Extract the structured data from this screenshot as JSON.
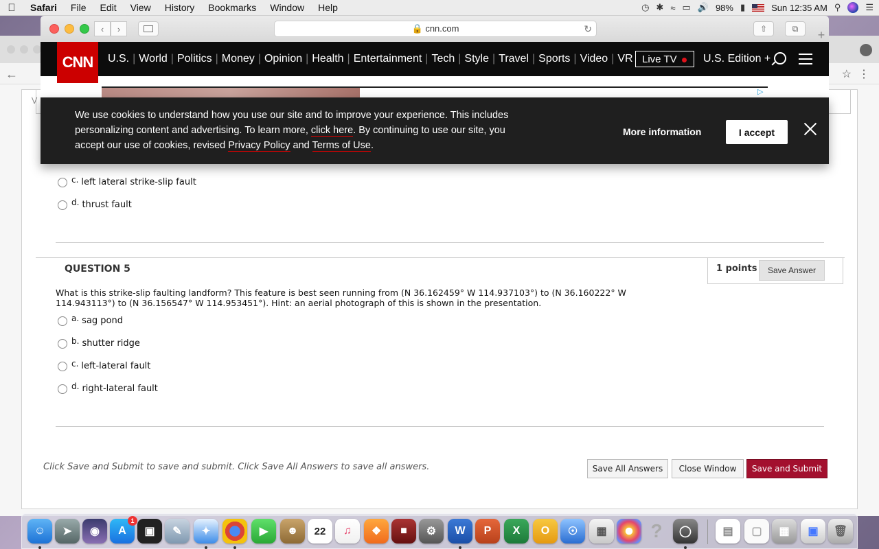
{
  "menubar": {
    "app": "Safari",
    "items": [
      "File",
      "Edit",
      "View",
      "History",
      "Bookmarks",
      "Window",
      "Help"
    ],
    "battery": "98%",
    "clock": "Sun 12:35 AM"
  },
  "safari": {
    "url": "cnn.com"
  },
  "cnn": {
    "logo": "CNN",
    "links": [
      "U.S.",
      "World",
      "Politics",
      "Money",
      "Opinion",
      "Health",
      "Entertainment",
      "Tech",
      "Style",
      "Travel",
      "Sports",
      "Video",
      "VR"
    ],
    "live_tv": "Live TV",
    "edition": "U.S. Edition +"
  },
  "cookie": {
    "text_1": "We use cookies to understand how you use our site and to improve your experience. This includes personalizing content and advertising. To learn more, ",
    "link_click_here": "click here",
    "text_2": ". By continuing to use our site, you accept our use of cookies, revised ",
    "link_privacy": "Privacy Policy",
    "text_3": " and ",
    "link_terms": "Terms of Use",
    "text_4": ".",
    "more_info": "More information",
    "accept": "I accept"
  },
  "prev_question": {
    "options": [
      {
        "letter": "c.",
        "text": "left lateral strike-slip fault"
      },
      {
        "letter": "d.",
        "text": "thrust fault"
      }
    ]
  },
  "question5": {
    "title": "QUESTION 5",
    "points": "1 points",
    "save_answer": "Save Answer",
    "text": "What is this strike-slip faulting landform? This feature is best seen running from (N 36.162459° W 114.937103°) to (N 36.160222° W 114.943113°) to (N  36.156547° W 114.953451°). Hint: an aerial photograph of this is shown in the presentation.",
    "options": [
      {
        "letter": "a.",
        "text": "sag pond"
      },
      {
        "letter": "b.",
        "text": "shutter ridge"
      },
      {
        "letter": "c.",
        "text": "left-lateral fault"
      },
      {
        "letter": "d.",
        "text": "right-lateral fault"
      }
    ]
  },
  "footer": {
    "note": "Click Save and Submit to save and submit. Click Save All Answers to save all answers.",
    "save_all": "Save All Answers",
    "close_window": "Close Window",
    "save_submit": "Save and Submit"
  },
  "dock": {
    "calendar_day": "22",
    "appstore_badge": "1"
  }
}
